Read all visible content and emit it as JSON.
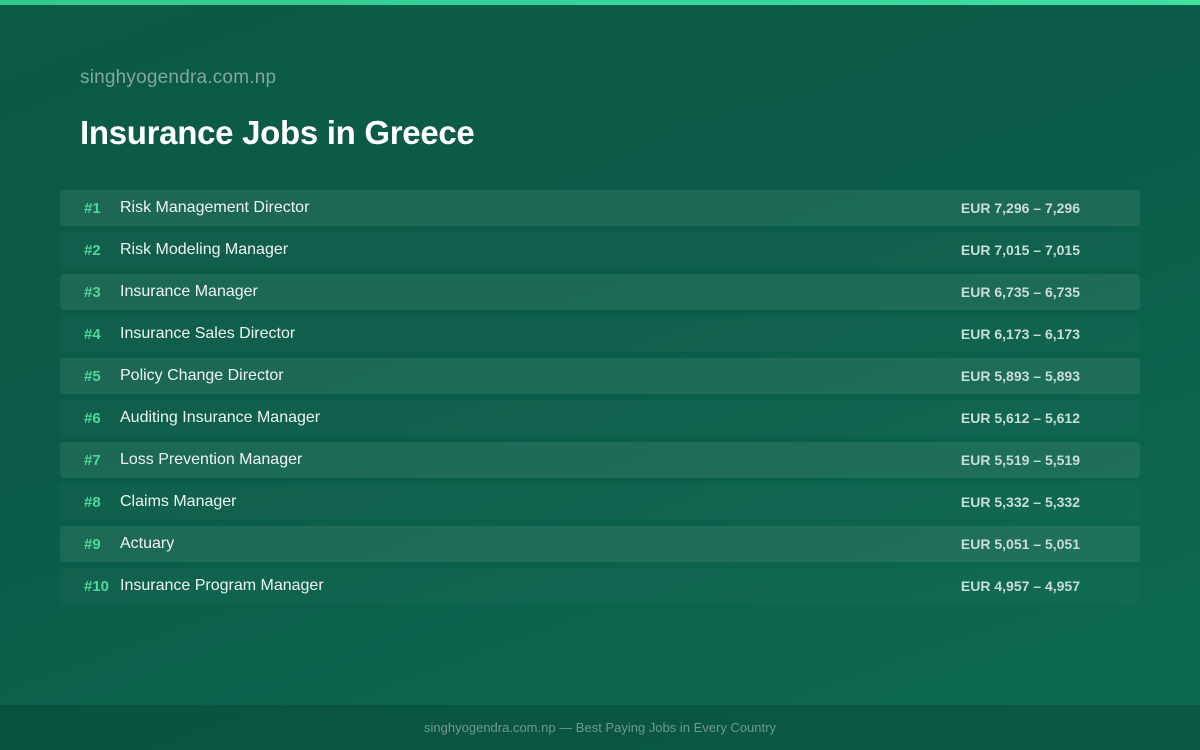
{
  "header": {
    "site_name": "singhyogendra.com.np",
    "title": "Insurance Jobs in Greece"
  },
  "jobs": [
    {
      "rank": "#1",
      "title": "Risk Management Director",
      "salary": "EUR 7,296 – 7,296"
    },
    {
      "rank": "#2",
      "title": "Risk Modeling Manager",
      "salary": "EUR 7,015 – 7,015"
    },
    {
      "rank": "#3",
      "title": "Insurance Manager",
      "salary": "EUR 6,735 – 6,735"
    },
    {
      "rank": "#4",
      "title": "Insurance Sales Director",
      "salary": "EUR 6,173 – 6,173"
    },
    {
      "rank": "#5",
      "title": "Policy Change Director",
      "salary": "EUR 5,893 – 5,893"
    },
    {
      "rank": "#6",
      "title": "Auditing Insurance Manager",
      "salary": "EUR 5,612 – 5,612"
    },
    {
      "rank": "#7",
      "title": "Loss Prevention Manager",
      "salary": "EUR 5,519 – 5,519"
    },
    {
      "rank": "#8",
      "title": "Claims Manager",
      "salary": "EUR 5,332 – 5,332"
    },
    {
      "rank": "#9",
      "title": "Actuary",
      "salary": "EUR 5,051 – 5,051"
    },
    {
      "rank": "#10",
      "title": "Insurance Program Manager",
      "salary": "EUR 4,957 – 4,957"
    }
  ],
  "footer": {
    "text": "singhyogendra.com.np — Best Paying Jobs in Every Country"
  },
  "colors": {
    "accent": "#34d399",
    "rank": "#4fd79a",
    "background": "#0a5c48"
  }
}
